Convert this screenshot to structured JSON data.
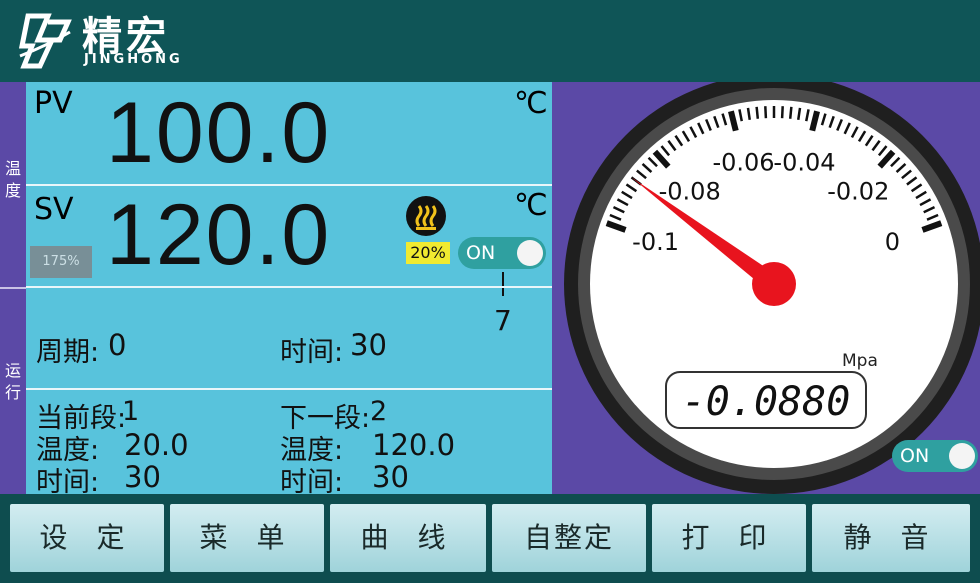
{
  "header": {
    "brand_cn": "精宏",
    "brand_en": "JINGHONG"
  },
  "left_tabs": {
    "temperature": "温度",
    "run": "运行"
  },
  "zoom_badge": "175%",
  "pv": {
    "label": "PV",
    "value": "100.0",
    "unit": "℃"
  },
  "sv": {
    "label": "SV",
    "value": "120.0",
    "unit": "℃"
  },
  "heater": {
    "icon": "heater-icon",
    "percent": "20%"
  },
  "toggle_main": {
    "label": "ON",
    "state": true
  },
  "marker_value": "7",
  "run": {
    "cycle_label": "周期:",
    "cycle_value": "0",
    "time_label": "时间:",
    "time_value": "30"
  },
  "segments": {
    "current_label": "当前段:",
    "current_value": "1",
    "next_label": "下一段:",
    "next_value": "2",
    "cur_temp_label": "温度:",
    "cur_temp_value": "20.0",
    "cur_time_label": "时间:",
    "cur_time_value": "30",
    "next_temp_label": "温度:",
    "next_temp_value": "120.0",
    "next_time_label": "时间:",
    "next_time_value": "30"
  },
  "gauge": {
    "ticks": [
      "-0.1",
      "-0.08",
      "-0.06",
      "-0.04",
      "-0.02",
      "0"
    ],
    "unit": "Mpa",
    "reading": "-0.0880",
    "needle_value": -0.088,
    "range": [
      -0.1,
      0
    ],
    "needle_color": "#e8141e"
  },
  "toggle_gauge": {
    "label": "ON",
    "state": true
  },
  "footer": {
    "buttons": [
      "设 定",
      "菜 单",
      "曲 线",
      "自整定",
      "打 印",
      "静 音"
    ]
  },
  "colors": {
    "header": "#0f5557",
    "panel": "#58c3dc",
    "purple": "#5b49a6",
    "toggle": "#2fa0a0"
  }
}
